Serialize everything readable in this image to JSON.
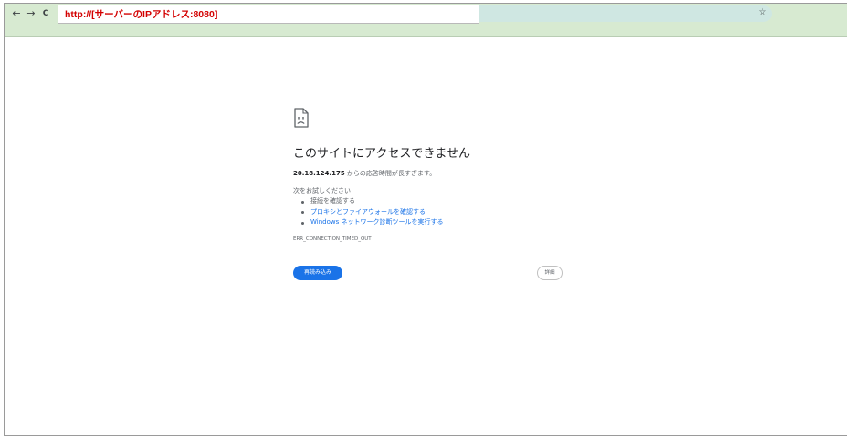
{
  "toolbar": {
    "back_glyph": "←",
    "forward_glyph": "→",
    "reload_glyph": "C",
    "bookmark_glyph": "☆",
    "annotation_text": "http://[サーバーのIPアドレス:8080]"
  },
  "error_page": {
    "icon": "sad-page-icon",
    "title": "このサイトにアクセスできません",
    "host": "20.18.124.175",
    "subtitle_rest": " からの応答時間が長すぎます。",
    "suggestions_heading": "次をお試しください",
    "suggestions": [
      {
        "text": "接続を確認する",
        "link": false
      },
      {
        "text": "プロキシとファイアウォールを確認する",
        "link": true
      },
      {
        "text": "Windows ネットワーク診断ツールを実行する",
        "link": true
      }
    ],
    "error_code": "ERR_CONNECTION_TIMED_OUT",
    "reload_label": "再読み込み",
    "details_label": "詳細"
  },
  "colors": {
    "toolbar_bg": "#d7ead1",
    "annotation_text": "#d30000",
    "primary_button": "#1a73e8",
    "link": "#1a73e8"
  }
}
